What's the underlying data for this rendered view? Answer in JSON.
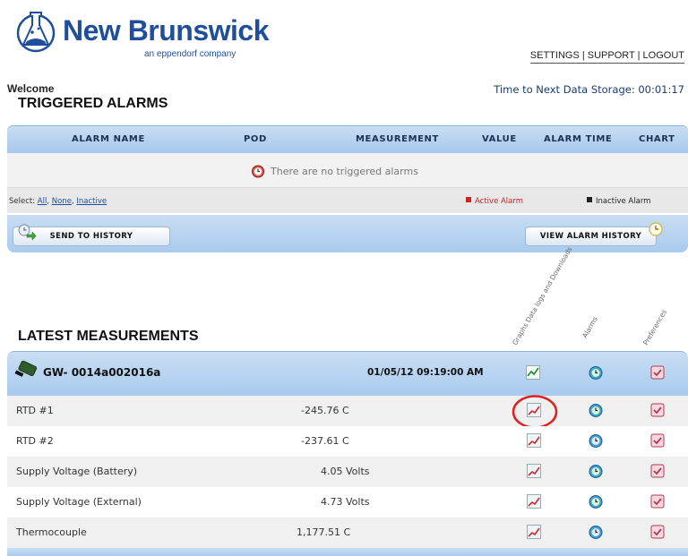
{
  "header": {
    "brand": "New Brunswick",
    "brand_sub": "an eppendorf company",
    "nav": [
      "SETTINGS",
      "SUPPORT",
      "LOGOUT"
    ],
    "nav_sep": " | "
  },
  "welcome": "Welcome",
  "next_storage": "Time to Next Data Storage: 00:01:17",
  "alarms": {
    "title": "TRIGGERED ALARMS",
    "columns": [
      "ALARM NAME",
      "POD",
      "MEASUREMENT",
      "VALUE",
      "ALARM TIME",
      "CHART"
    ],
    "empty_message": "There are no triggered alarms",
    "select_label": "Select:",
    "select_options": [
      "All",
      "None",
      "Inactive"
    ],
    "legend_active": "Active Alarm",
    "legend_inactive": "Inactive Alarm",
    "send_button": "SEND TO HISTORY",
    "view_button": "VIEW ALARM HISTORY"
  },
  "colors": {
    "active_alarm": "#d02020",
    "inactive_alarm": "#222222",
    "header_blue": "#a8caee",
    "brand_blue": "#1f4f9a"
  },
  "measurements": {
    "title": "LATEST MEASUREMENTS",
    "col_graphs": "Graphs Data logs and Downloads",
    "col_alarms": "Alarms",
    "col_prefs": "Preferences",
    "gateway": {
      "name": "GW- 0014a002016a",
      "date": "01/05/12 09:19:00 AM"
    },
    "rows": [
      {
        "name": "RTD #1",
        "value": "-245.76 C"
      },
      {
        "name": "RTD #2",
        "value": "-237.61 C"
      },
      {
        "name": "Supply Voltage (Battery)",
        "value": "4.05 Volts"
      },
      {
        "name": "Supply Voltage (External)",
        "value": "4.73 Volts"
      },
      {
        "name": "Thermocouple",
        "value": "1,177.51 C"
      }
    ]
  }
}
